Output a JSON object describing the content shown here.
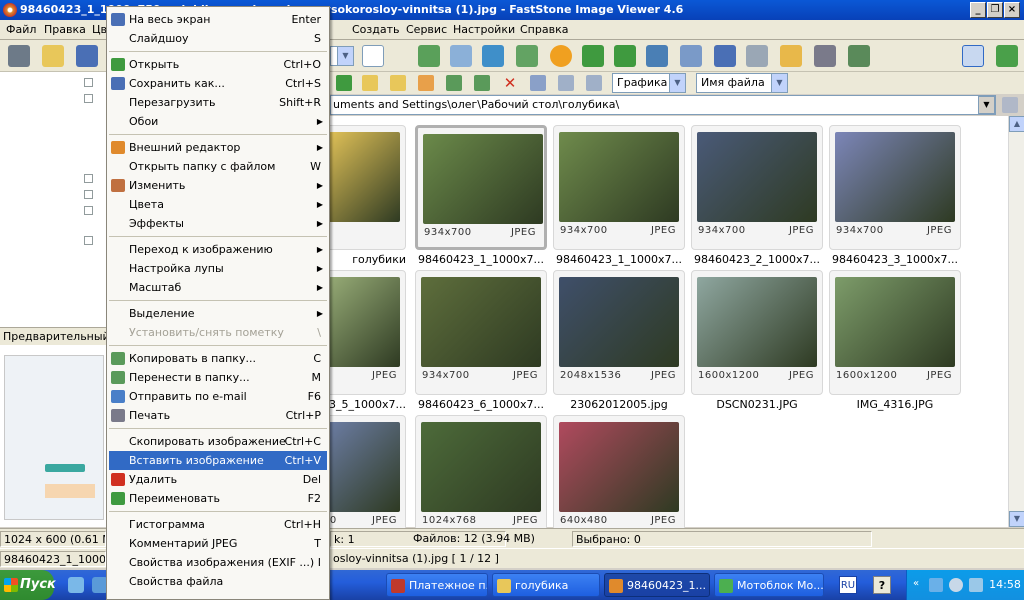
{
  "title_bar": {
    "title": "98460423_1_1000x750_golubika-vysokoroslaya-vysokorosloy-vinnitsa (1).jpg - FastStone Image Viewer 4.6",
    "buttons": [
      "_",
      "❐",
      "×"
    ]
  },
  "menu_bar": [
    "Файл",
    "Правка",
    "Цв",
    "Создать",
    "Сервис",
    "Настройки",
    "Справка"
  ],
  "toolbar": {
    "view_combo": "Графика",
    "sort_combo": "Имя файла"
  },
  "path": "uments and Settings\\олег\\Рабочий стол\\голубика\\",
  "left_panel": {
    "preview_label": "Предварительный п"
  },
  "context_menu": {
    "items": [
      {
        "label": "На весь экран",
        "shortcut": "Enter",
        "icon": "fullscreen-icon"
      },
      {
        "label": "Слайдшоу",
        "shortcut": "S"
      },
      {
        "sep": true
      },
      {
        "label": "Открыть",
        "shortcut": "Ctrl+O",
        "icon": "open-icon"
      },
      {
        "label": "Сохранить как...",
        "shortcut": "Ctrl+S",
        "icon": "save-icon"
      },
      {
        "label": "Перезагрузить",
        "shortcut": "Shift+R"
      },
      {
        "label": "Обои",
        "submenu": true
      },
      {
        "sep": true
      },
      {
        "label": "Внешний редактор",
        "submenu": true,
        "icon": "external-editor-icon"
      },
      {
        "label": "Открыть папку с файлом",
        "shortcut": "W"
      },
      {
        "label": "Изменить",
        "submenu": true,
        "icon": "edit-icon"
      },
      {
        "label": "Цвета",
        "submenu": true
      },
      {
        "label": "Эффекты",
        "submenu": true
      },
      {
        "sep": true
      },
      {
        "label": "Переход к изображению",
        "submenu": true
      },
      {
        "label": "Настройка лупы",
        "submenu": true
      },
      {
        "label": "Масштаб",
        "submenu": true
      },
      {
        "sep": true
      },
      {
        "label": "Выделение",
        "submenu": true
      },
      {
        "label": "Установить/снять пометку",
        "shortcut": "\\",
        "disabled": true
      },
      {
        "sep": true
      },
      {
        "label": "Копировать в папку...",
        "shortcut": "C",
        "icon": "copy-folder-icon"
      },
      {
        "label": "Перенести в папку...",
        "shortcut": "M",
        "icon": "move-folder-icon"
      },
      {
        "label": "Отправить по e-mail",
        "shortcut": "F6",
        "icon": "email-icon"
      },
      {
        "label": "Печать",
        "shortcut": "Ctrl+P",
        "icon": "print-icon"
      },
      {
        "sep": true
      },
      {
        "label": "Скопировать изображение",
        "shortcut": "Ctrl+C"
      },
      {
        "label": "Вставить изображение",
        "shortcut": "Ctrl+V",
        "highlighted": true
      },
      {
        "label": "Удалить",
        "shortcut": "Del",
        "icon": "delete-icon"
      },
      {
        "label": "Переименовать",
        "shortcut": "F2",
        "icon": "rename-icon"
      },
      {
        "sep": true
      },
      {
        "label": "Гистограмма",
        "shortcut": "Ctrl+H"
      },
      {
        "label": "Комментарий JPEG",
        "shortcut": "T"
      },
      {
        "label": "Свойства изображения (EXIF ...)",
        "shortcut": "I"
      },
      {
        "label": "Свойства файла"
      }
    ]
  },
  "thumbnails": [
    {
      "dims": "",
      "fmt": "",
      "caption": "голубики",
      "color": "#e8c75a"
    },
    {
      "dims": "934x700",
      "fmt": "JPEG",
      "caption": "98460423_1_1000x7...",
      "color": "#6b8a4a",
      "selected": true
    },
    {
      "dims": "934x700",
      "fmt": "JPEG",
      "caption": "98460423_1_1000x7...",
      "color": "#6f8b4c"
    },
    {
      "dims": "934x700",
      "fmt": "JPEG",
      "caption": "98460423_2_1000x7...",
      "color": "#4a5a78"
    },
    {
      "dims": "934x700",
      "fmt": "JPEG",
      "caption": "98460423_3_1000x7...",
      "color": "#7c86b8"
    },
    {
      "dims": "",
      "fmt": "JPEG",
      "caption": "3_5_1000x7...",
      "color": "#9bb07a"
    },
    {
      "dims": "934x700",
      "fmt": "JPEG",
      "caption": "98460423_6_1000x7...",
      "color": "#5e6e3c"
    },
    {
      "dims": "2048x1536",
      "fmt": "JPEG",
      "caption": "23062012005.jpg",
      "color": "#3f4f6a"
    },
    {
      "dims": "1600x1200",
      "fmt": "JPEG",
      "caption": "DSCN0231.JPG",
      "color": "#8fa7a0"
    },
    {
      "dims": "1600x1200",
      "fmt": "JPEG",
      "caption": "IMG_4316.JPG",
      "color": "#7d9c6a"
    },
    {
      "dims": "00",
      "fmt": "JPEG",
      "caption": "",
      "color": "#6e7fa8"
    },
    {
      "dims": "1024x768",
      "fmt": "JPEG",
      "caption": "",
      "color": "#4d6b3a"
    },
    {
      "dims": "640x480",
      "fmt": "JPEG",
      "caption": "",
      "color": "#b04a5e"
    }
  ],
  "status": {
    "resolution": "1024 x 600 (0.61 MP)",
    "selected_count": "k: 1",
    "files": "Файлов: 12 (3.94 MB)",
    "chosen": "Выбрано: 0",
    "filename_left": "98460423_1_1000x",
    "filename_right": "osloy-vinnitsa (1).jpg [ 1 / 12 ]"
  },
  "taskbar": {
    "start": "Пуск",
    "buttons": [
      {
        "label": "Платежное п...",
        "color": "#c0392b"
      },
      {
        "label": "голубика",
        "color": "#e8c75a"
      },
      {
        "label": "98460423_1...",
        "color": "#e08a2c",
        "active": true
      },
      {
        "label": "Мотоблок Мо...",
        "color": "#4caf50"
      }
    ],
    "lang": "RU",
    "clock": "14:58"
  }
}
